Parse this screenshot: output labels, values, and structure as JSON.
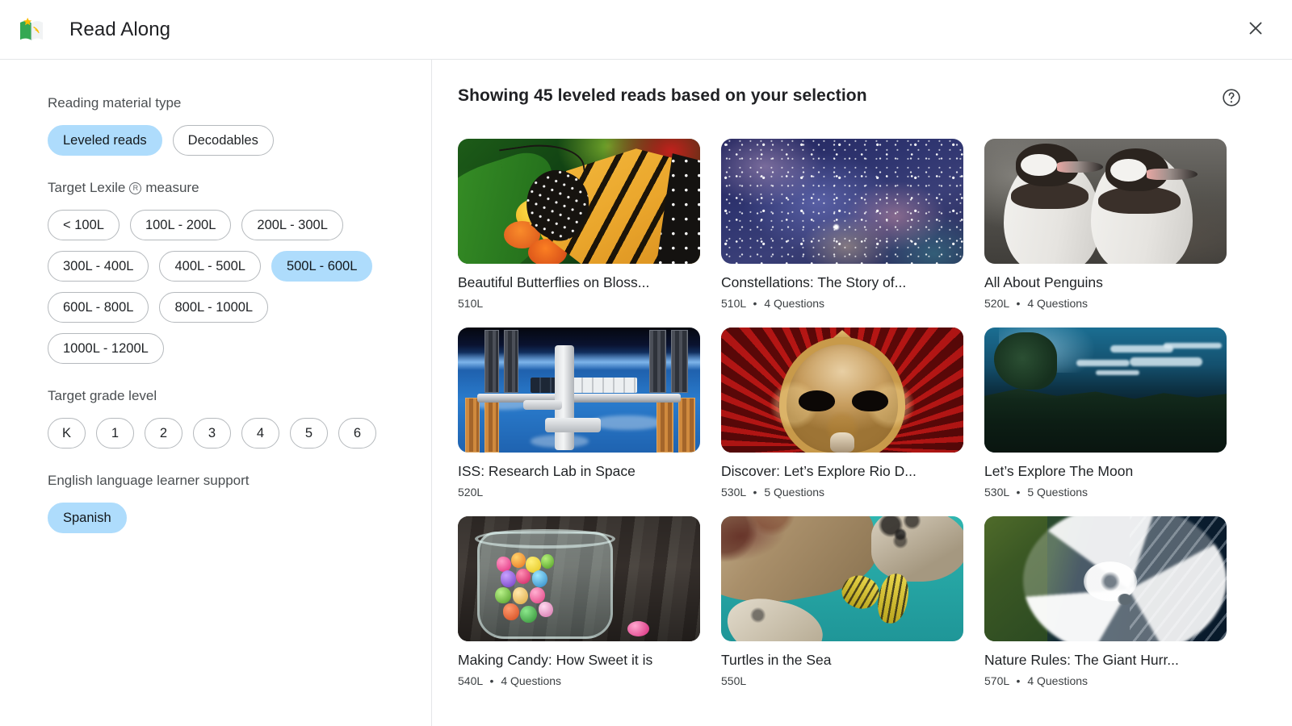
{
  "header": {
    "app_title": "Read Along",
    "logo_icon": "read-along-book-star-logo",
    "close_icon": "close-icon"
  },
  "sidebar": {
    "groups": [
      {
        "label": "Reading material type",
        "name": "reading-material-type",
        "options": [
          {
            "label": "Leveled reads",
            "selected": true
          },
          {
            "label": "Decodables",
            "selected": false
          }
        ]
      },
      {
        "label_prefix": "Target Lexile",
        "label_suffix": "measure",
        "reg_glyph": "R",
        "name": "target-lexile-measure",
        "options": [
          {
            "label": "< 100L",
            "selected": false
          },
          {
            "label": "100L - 200L",
            "selected": false
          },
          {
            "label": "200L - 300L",
            "selected": false
          },
          {
            "label": "300L - 400L",
            "selected": false
          },
          {
            "label": "400L - 500L",
            "selected": false
          },
          {
            "label": "500L - 600L",
            "selected": true
          },
          {
            "label": "600L - 800L",
            "selected": false
          },
          {
            "label": "800L - 1000L",
            "selected": false
          },
          {
            "label": "1000L - 1200L",
            "selected": false
          }
        ]
      },
      {
        "label": "Target grade level",
        "name": "target-grade-level",
        "options": [
          {
            "label": "K",
            "selected": false
          },
          {
            "label": "1",
            "selected": false
          },
          {
            "label": "2",
            "selected": false
          },
          {
            "label": "3",
            "selected": false
          },
          {
            "label": "4",
            "selected": false
          },
          {
            "label": "5",
            "selected": false
          },
          {
            "label": "6",
            "selected": false
          }
        ]
      },
      {
        "label": "English language learner support",
        "name": "english-language-learner-support",
        "options": [
          {
            "label": "Spanish",
            "selected": true
          }
        ]
      }
    ]
  },
  "content": {
    "results_title": "Showing 45 leveled reads based on your selection",
    "result_count": 45,
    "help_icon": "help-circle-icon",
    "cards": [
      {
        "title": "Beautiful Butterflies on Bloss...",
        "lexile": "510L",
        "questions": "",
        "art": "a-butterfly",
        "thumb_name": "thumbnail-monarch-butterfly-on-flowers"
      },
      {
        "title": "Constellations: The Story of...",
        "lexile": "510L",
        "questions": "4 Questions",
        "art": "a-galaxy",
        "thumb_name": "thumbnail-starry-nebula-sky"
      },
      {
        "title": "All About Penguins",
        "lexile": "520L",
        "questions": "4 Questions",
        "art": "a-peng",
        "thumb_name": "thumbnail-two-humboldt-penguins"
      },
      {
        "title": "ISS: Research Lab in Space",
        "lexile": "520L",
        "questions": "",
        "art": "a-iss",
        "thumb_name": "thumbnail-international-space-station-over-earth"
      },
      {
        "title": "Discover: Let’s Explore Rio D...",
        "lexile": "530L",
        "questions": "5 Questions",
        "art": "a-mask",
        "thumb_name": "thumbnail-golden-carnival-mask-red-feathers"
      },
      {
        "title": "Let’s Explore The Moon",
        "lexile": "530L",
        "questions": "5 Questions",
        "art": "a-moon",
        "thumb_name": "thumbnail-night-forest-landscape"
      },
      {
        "title": "Making Candy: How Sweet it is",
        "lexile": "540L",
        "questions": "4 Questions",
        "art": "a-candy",
        "thumb_name": "thumbnail-candy-jar-on-wood"
      },
      {
        "title": "Turtles in the Sea",
        "lexile": "550L",
        "questions": "",
        "art": "a-turtle",
        "thumb_name": "thumbnail-sea-turtle-with-pilot-fish"
      },
      {
        "title": "Nature Rules: The Giant Hurr...",
        "lexile": "570L",
        "questions": "4 Questions",
        "art": "a-hurr",
        "thumb_name": "thumbnail-hurricane-satellite-view"
      }
    ]
  },
  "colors": {
    "chip_selected_bg": "#aedcfc",
    "chip_border": "#b5b9bd",
    "divider": "#e4e6e8",
    "text_primary": "#202124",
    "text_secondary": "#5f6368",
    "logo_green": "#34a853",
    "logo_star": "#fbbc04"
  }
}
